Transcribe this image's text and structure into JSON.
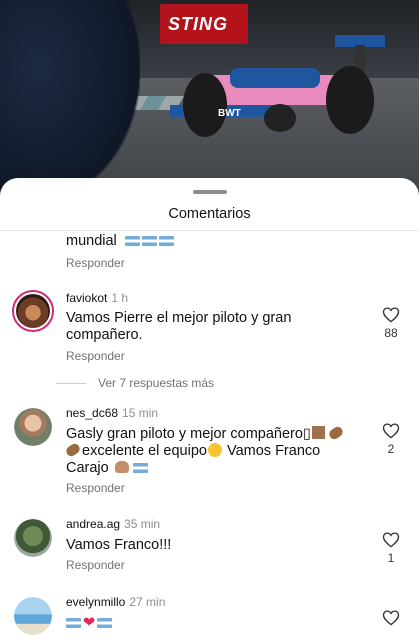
{
  "photo": {
    "banner_text": "STING"
  },
  "sheet": {
    "title": "Comentarios"
  },
  "comments": [
    {
      "text": "mundial",
      "flags": 3,
      "reply": "Responder"
    },
    {
      "username": "faviokot",
      "time": "1 h",
      "text": "Vamos Pierre el mejor piloto y gran compañero.",
      "reply": "Responder",
      "likes": "88"
    },
    {
      "view_replies": "Ver 7 respuestas más"
    },
    {
      "username": "nes_dc68",
      "time": "15 min",
      "line1": "Gasly gran piloto y mejor compañero▯",
      "line2": "excelente el equipo",
      "line2b": " Vamos Franco",
      "line3": "Carajo",
      "reply": "Responder",
      "likes": "2"
    },
    {
      "username": "andrea.ag",
      "time": "35 min",
      "text": "Vamos Franco!!!",
      "reply": "Responder",
      "likes": "1"
    },
    {
      "username": "evelynmillo",
      "time": "27 min",
      "hearts": "❤"
    }
  ],
  "icons": {
    "like": "heart-outline-icon"
  },
  "colors": {
    "accent_ring": "#d62976",
    "secondary_text": "#737373"
  }
}
